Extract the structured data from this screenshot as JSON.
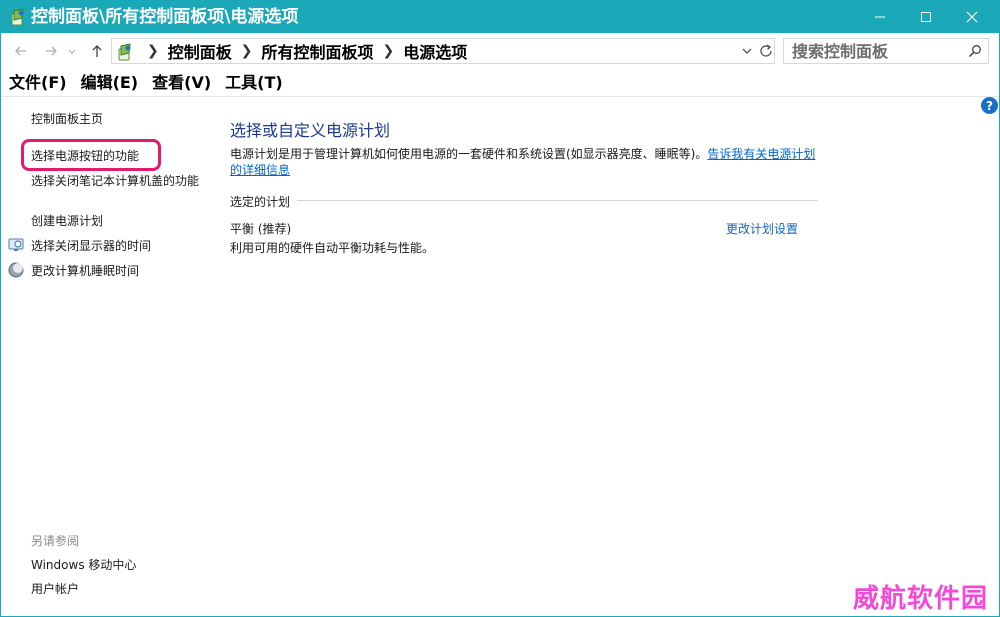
{
  "window": {
    "title": "控制面板\\所有控制面板项\\电源选项"
  },
  "address": {
    "crumbs": [
      "控制面板",
      "所有控制面板项",
      "电源选项"
    ]
  },
  "search": {
    "placeholder": "搜索控制面板"
  },
  "menu": [
    "文件(F)",
    "编辑(E)",
    "查看(V)",
    "工具(T)"
  ],
  "sidebar": {
    "home": "控制面板主页",
    "links": [
      "选择电源按钮的功能",
      "选择关闭笔记本计算机盖的功能",
      "创建电源计划",
      "选择关闭显示器的时间",
      "更改计算机睡眠时间"
    ],
    "see_also_label": "另请参阅",
    "see_also": [
      "Windows 移动中心",
      "用户帐户"
    ]
  },
  "main": {
    "title": "选择或自定义电源计划",
    "description": "电源计划是用于管理计算机如何使用电源的一套硬件和系统设置(如显示器亮度、睡眠等)。",
    "description_link": "告诉我有关电源计划的详细信息",
    "section_label": "选定的计划",
    "plan_name": "平衡 (推荐)",
    "plan_description": "利用可用的硬件自动平衡功耗与性能。",
    "plan_settings_link": "更改计划设置"
  },
  "help_glyph": "?",
  "watermark": "威航软件园",
  "colors": {
    "titlebar": "#1ba8b8",
    "title_text": "#1e3a8c",
    "link": "#0066cc",
    "highlight": "#e41a72",
    "watermark": "#f14ad9"
  }
}
